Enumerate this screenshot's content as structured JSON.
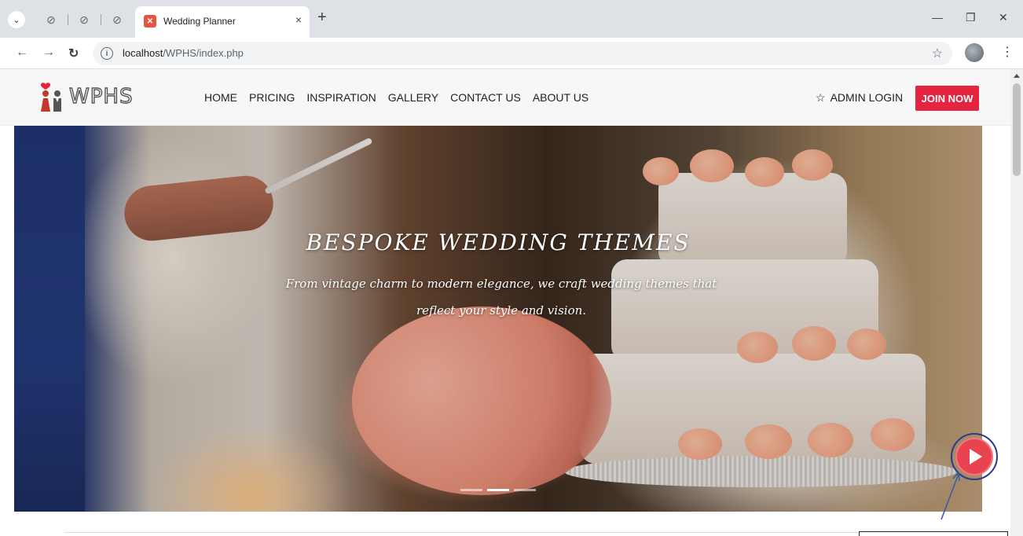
{
  "browser": {
    "tab_title": "Wedding Planner",
    "tab_close": "×",
    "new_tab": "+",
    "url_host": "localhost",
    "url_path": "/WPHS/index.php",
    "window_controls": [
      "—",
      "❐",
      "✕"
    ]
  },
  "site": {
    "logo_text": "WPHS",
    "nav": [
      "HOME",
      "PRICING",
      "INSPIRATION",
      "GALLERY",
      "CONTACT US",
      "ABOUT US"
    ],
    "admin_login": "ADMIN LOGIN",
    "join_now": "JOIN NOW",
    "accent_color": "#e5243f"
  },
  "hero": {
    "title": "BESPOKE WEDDING THEMES",
    "subtitle": "From vintage charm to modern elegance, we craft wedding themes that reflect your style and vision.",
    "slides": 3,
    "active_slide": 2
  },
  "icons": {
    "play": "play-icon",
    "star": "star-icon",
    "info": "info-icon"
  }
}
